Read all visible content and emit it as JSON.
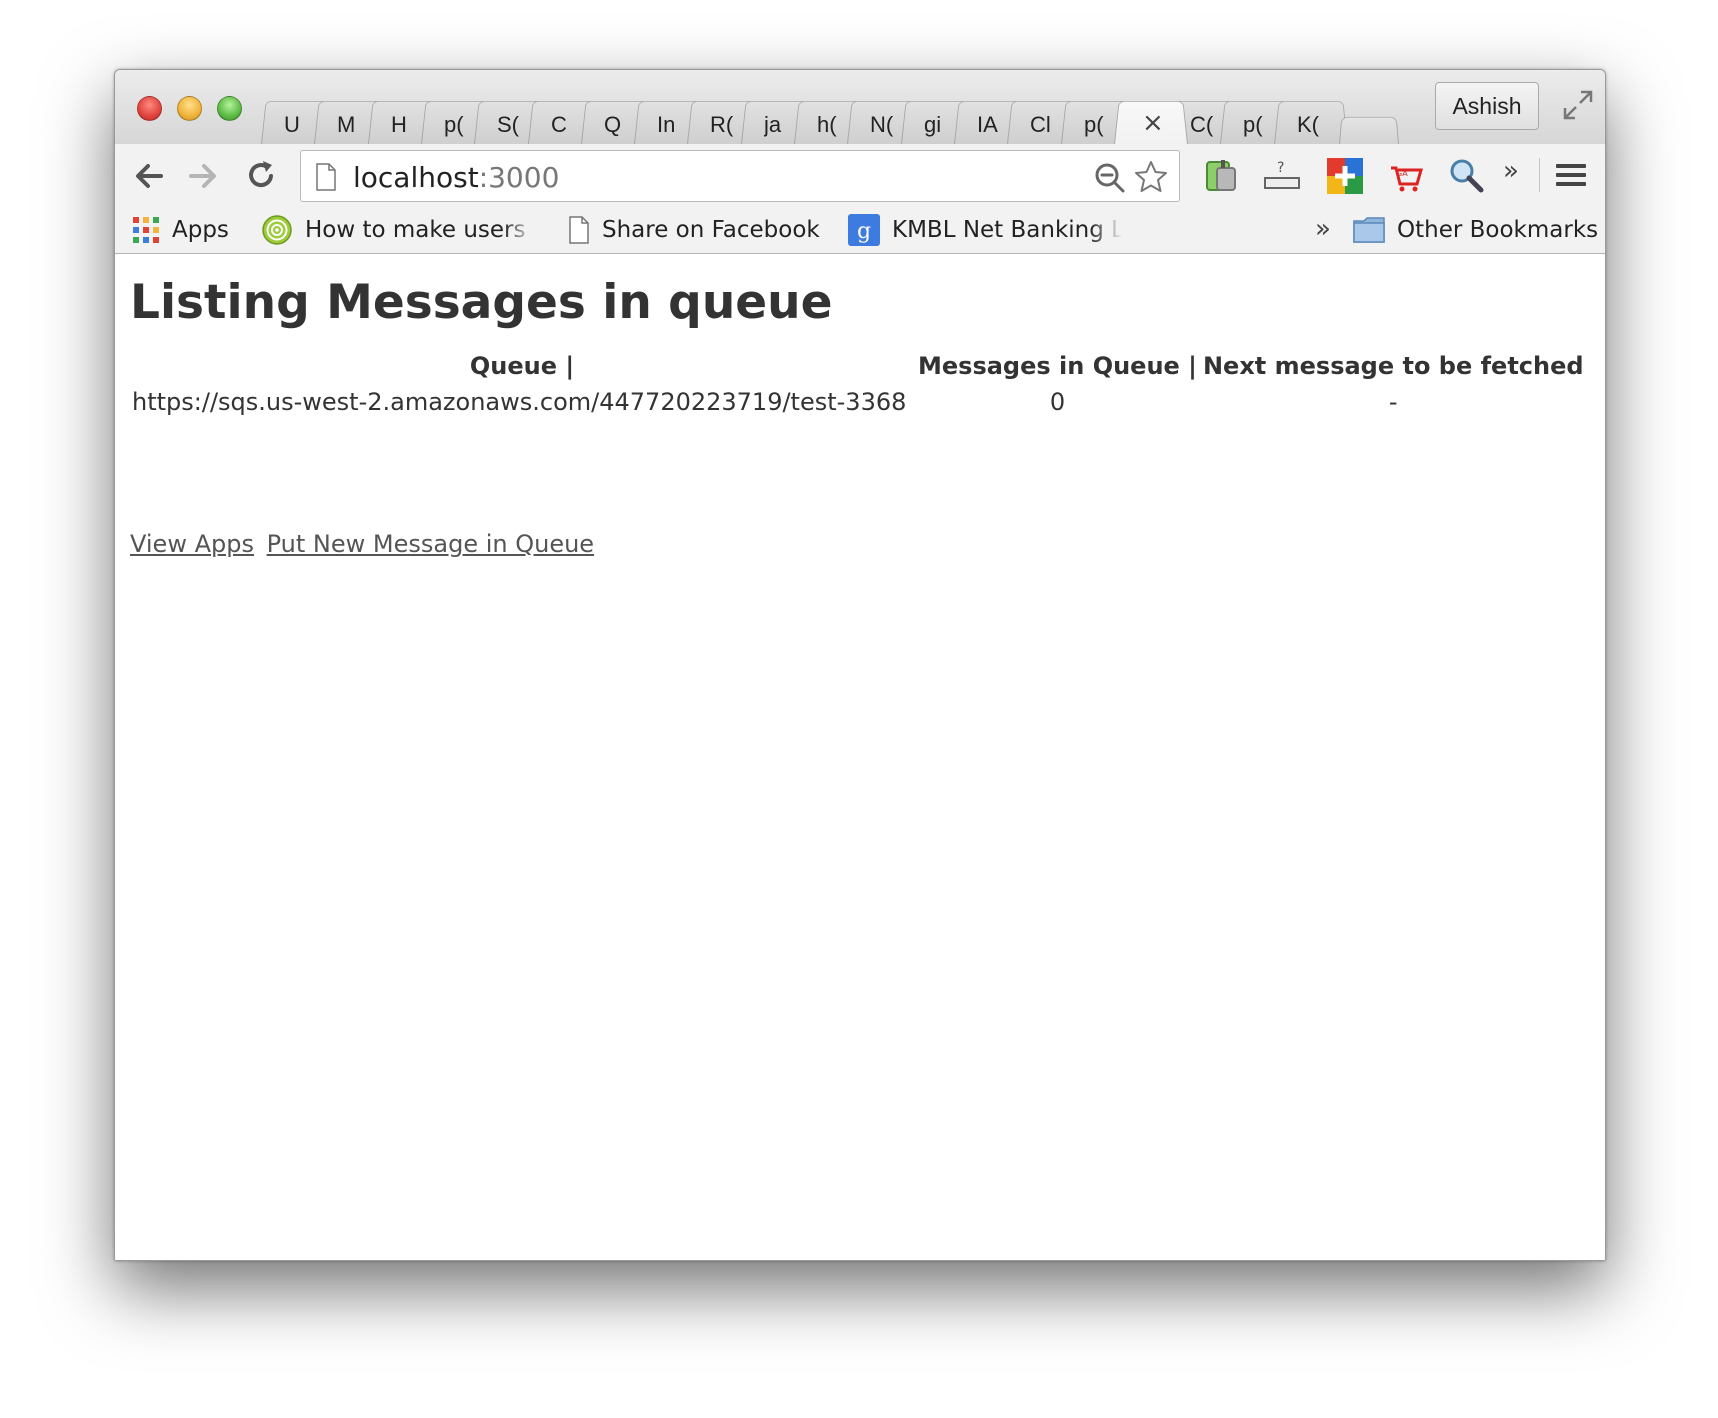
{
  "browser": {
    "tabs": [
      {
        "label": "U"
      },
      {
        "label": "M"
      },
      {
        "label": "H"
      },
      {
        "label": "p("
      },
      {
        "label": "S("
      },
      {
        "label": "C"
      },
      {
        "label": "Q"
      },
      {
        "label": "In"
      },
      {
        "label": "R("
      },
      {
        "label": "ja"
      },
      {
        "label": "h("
      },
      {
        "label": "N("
      },
      {
        "label": "gi"
      },
      {
        "label": "IA"
      },
      {
        "label": "Cl"
      },
      {
        "label": "p("
      },
      {
        "label": "",
        "active": true,
        "close": "×"
      },
      {
        "label": "C("
      },
      {
        "label": "p("
      },
      {
        "label": "K("
      }
    ],
    "profile_name": "Ashish",
    "url": {
      "host": "localhost",
      "port": ":3000"
    },
    "bookmarks": [
      {
        "label": "Apps",
        "icon": "apps-grid-icon"
      },
      {
        "label": "How to make users s",
        "icon": "target-icon"
      },
      {
        "label": "Share on Facebook",
        "icon": "page-icon"
      },
      {
        "label": "KMBL Net Banking Lo",
        "icon": "google-g-icon"
      }
    ],
    "more_bookmarks": "»",
    "other_bookmarks": "Other Bookmarks",
    "extensions_overflow": "»"
  },
  "page": {
    "title": "Listing Messages in queue",
    "table": {
      "headers": [
        "Queue |",
        "Messages in Queue |",
        "Next message to be fetched"
      ],
      "rows": [
        [
          "https://sqs.us-west-2.amazonaws.com/447720223719/test-3368",
          "0",
          "-"
        ]
      ]
    },
    "links": {
      "view_apps": "View Apps",
      "put_new_message": "Put New Message in Queue"
    }
  }
}
